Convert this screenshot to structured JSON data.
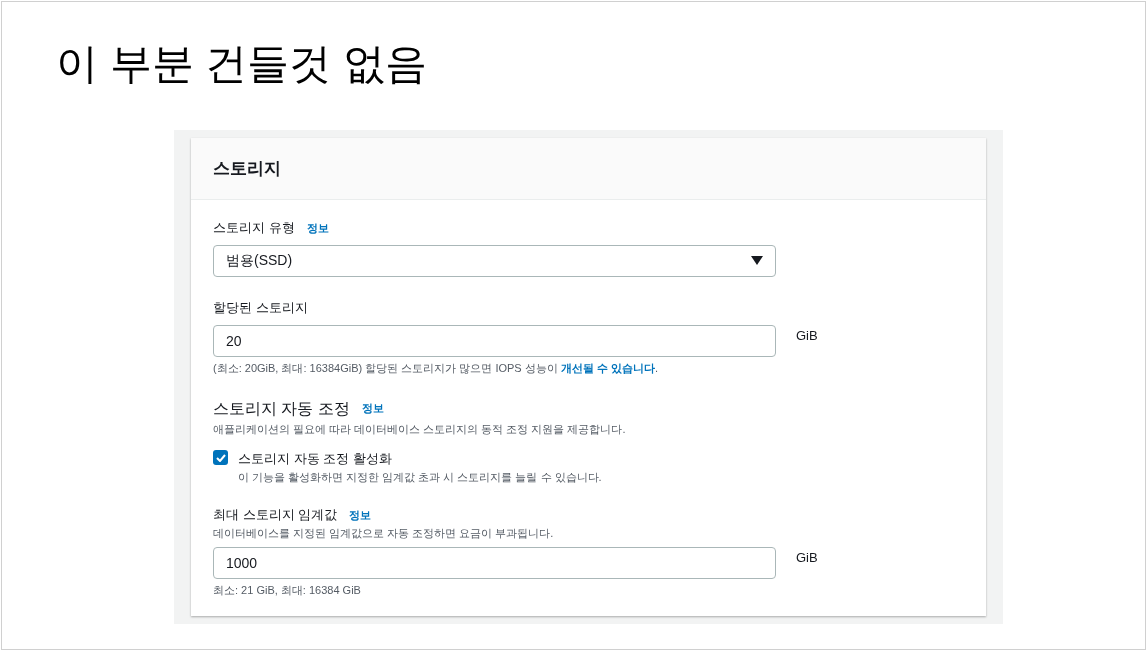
{
  "slide_title": "이 부분 건들것 없음",
  "panel": {
    "title": "스토리지",
    "storage_type": {
      "label": "스토리지 유형",
      "info": "정보",
      "value": "범용(SSD)"
    },
    "allocated": {
      "label": "할당된 스토리지",
      "value": "20",
      "unit": "GiB",
      "note": "(최소: 20GiB, 최대: 16384GiB) 할당된 스토리지가 많으면 IOPS 성능이 ",
      "note_link": "개선될 수 있습니다",
      "note_end": "."
    },
    "autoscaling": {
      "heading": "스토리지 자동 조정",
      "info": "정보",
      "description": "애플리케이션의 필요에 따라 데이터베이스 스토리지의 동적 조정 지원을 제공합니다.",
      "checkbox": {
        "label": "스토리지 자동 조정 활성화",
        "description": "이 기능을 활성화하면 지정한 임계값 초과 시 스토리지를 늘릴 수 있습니다.",
        "checked": true
      }
    },
    "max_threshold": {
      "label": "최대 스토리지 임계값",
      "info": "정보",
      "description": "데이터베이스를 지정된 임계값으로 자동 조정하면 요금이 부과됩니다.",
      "value": "1000",
      "unit": "GiB",
      "note": "최소: 21 GiB, 최대: 16384 GiB"
    }
  }
}
